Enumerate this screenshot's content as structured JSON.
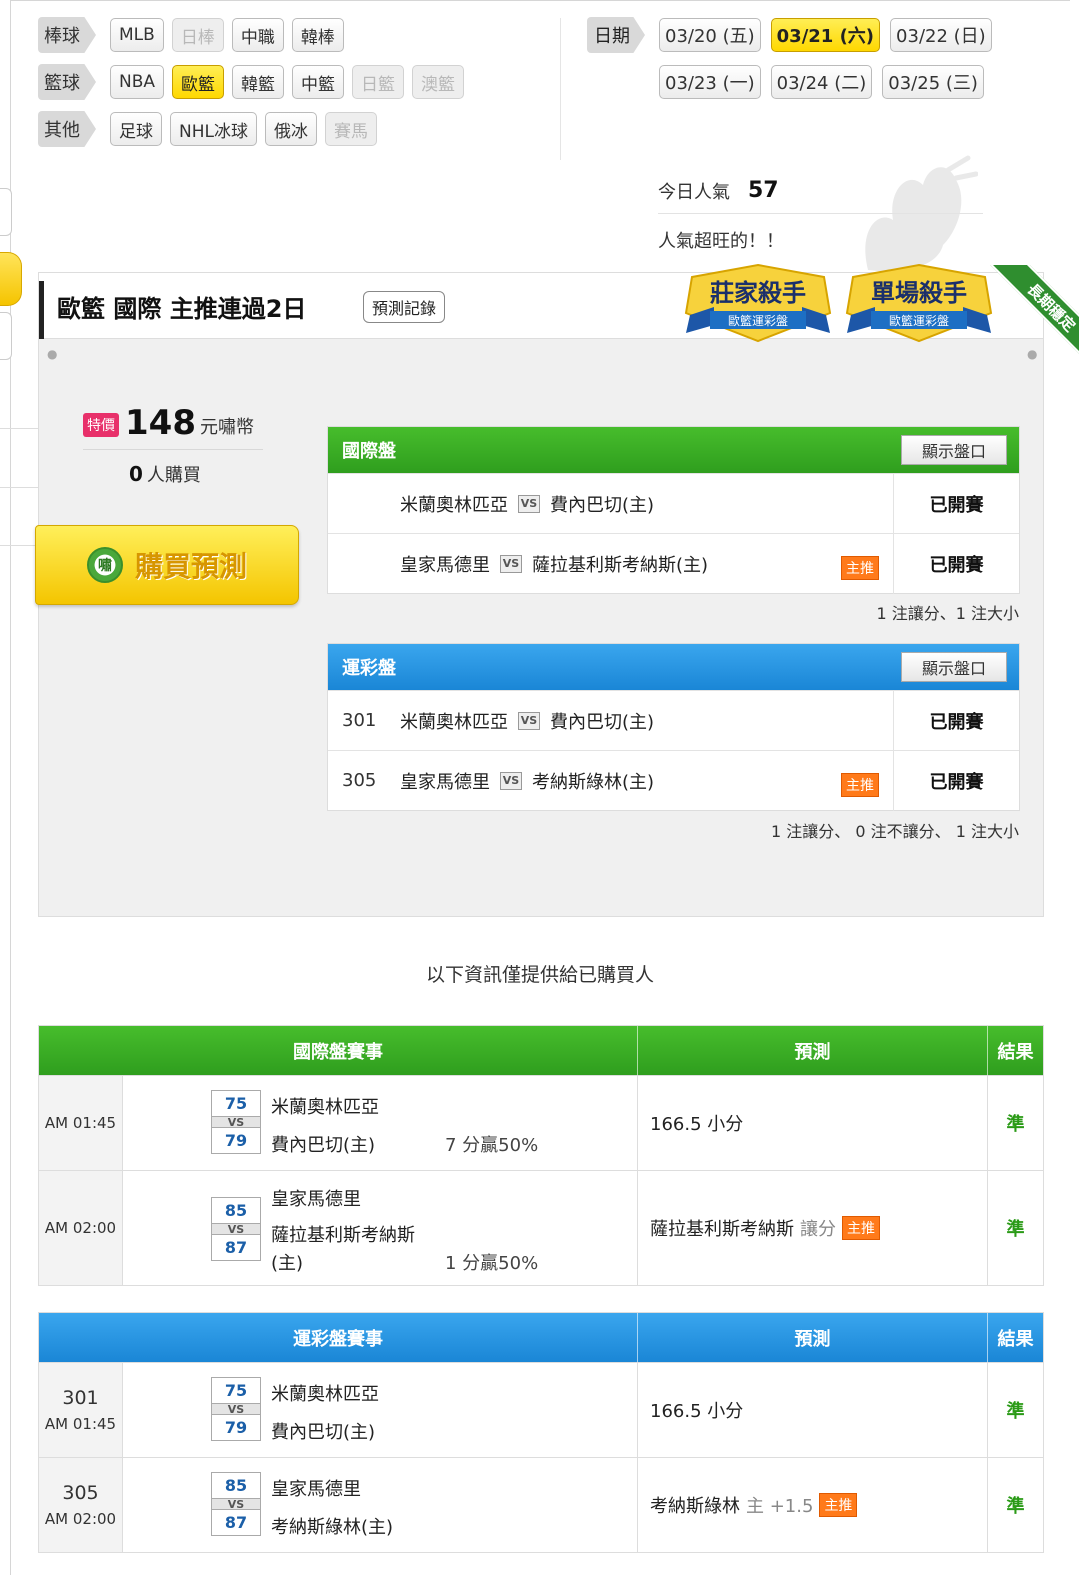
{
  "categories": [
    {
      "label": "棒球",
      "items": [
        {
          "label": "MLB",
          "state": "normal"
        },
        {
          "label": "日棒",
          "state": "disabled"
        },
        {
          "label": "中職",
          "state": "normal"
        },
        {
          "label": "韓棒",
          "state": "normal"
        }
      ]
    },
    {
      "label": "籃球",
      "items": [
        {
          "label": "NBA",
          "state": "normal"
        },
        {
          "label": "歐籃",
          "state": "active"
        },
        {
          "label": "韓籃",
          "state": "normal"
        },
        {
          "label": "中籃",
          "state": "normal"
        },
        {
          "label": "日籃",
          "state": "disabled"
        },
        {
          "label": "澳籃",
          "state": "disabled"
        }
      ]
    },
    {
      "label": "其他",
      "items": [
        {
          "label": "足球",
          "state": "normal"
        },
        {
          "label": "NHL冰球",
          "state": "normal"
        },
        {
          "label": "俄冰",
          "state": "normal"
        },
        {
          "label": "賽馬",
          "state": "disabled"
        }
      ]
    }
  ],
  "dates": {
    "label": "日期",
    "items": [
      {
        "label": "03/20 (五)",
        "active": false
      },
      {
        "label": "03/21 (六)",
        "active": true
      },
      {
        "label": "03/22 (日)",
        "active": false
      },
      {
        "label": "03/23 (一)",
        "active": false
      },
      {
        "label": "03/24 (二)",
        "active": false
      },
      {
        "label": "03/25 (三)",
        "active": false
      }
    ]
  },
  "popularity": {
    "label": "今日人氣",
    "value": "57",
    "message": "人氣超旺的！！"
  },
  "panel": {
    "title": "歐籃 國際 主推連過2日",
    "record_button": "預測記錄",
    "badge1": {
      "title": "莊家殺手",
      "sub": "歐籃運彩盤"
    },
    "badge2": {
      "title": "單場殺手",
      "sub": "歐籃運彩盤"
    },
    "corner_ribbon": "長期穩定",
    "price_tag": "特價",
    "price": "148",
    "price_unit": "元嘯幣",
    "buyers_count": "0",
    "buyers_label": "人購買",
    "buy_coin": "嘯",
    "buy_button": "購買預測",
    "intl": {
      "title": "國際盤",
      "show_button": "顯示盤口",
      "rows": [
        {
          "no": "",
          "home": "米蘭奧林匹亞",
          "away": "費內巴切(主)",
          "main": false,
          "status": "已開賽"
        },
        {
          "no": "",
          "home": "皇家馬德里",
          "away": "薩拉基利斯考納斯(主)",
          "main": true,
          "status": "已開賽"
        }
      ],
      "note": "1 注讓分、1 注大小"
    },
    "lottery": {
      "title": "運彩盤",
      "show_button": "顯示盤口",
      "rows": [
        {
          "no": "301",
          "home": "米蘭奧林匹亞",
          "away": "費內巴切(主)",
          "main": false,
          "status": "已開賽"
        },
        {
          "no": "305",
          "home": "皇家馬德里",
          "away": "考納斯綠林(主)",
          "main": true,
          "status": "已開賽"
        }
      ],
      "note": "1 注讓分、 0 注不讓分、 1 注大小"
    },
    "vs": "VS",
    "main_pick": "主推"
  },
  "info_message": "以下資訊僅提供給已購買人",
  "results_intl": {
    "headers": [
      "國際盤賽事",
      "預測",
      "結果"
    ],
    "rows": [
      {
        "time": "AM 01:45",
        "score1": "75",
        "score2": "79",
        "team1": "米蘭奧林匹亞",
        "team2": "費內巴切(主)",
        "margin": "7 分贏50%",
        "prediction": "166.5 小分",
        "pred_extra": "",
        "main": false,
        "result": "準"
      },
      {
        "time": "AM 02:00",
        "score1": "85",
        "score2": "87",
        "team1": "皇家馬德里",
        "team2a": "薩拉基利斯考納斯",
        "team2b": "(主)",
        "margin": "1 分贏50%",
        "prediction": "薩拉基利斯考納斯",
        "pred_extra": "讓分",
        "main": true,
        "result": "準"
      }
    ]
  },
  "results_lottery": {
    "headers": [
      "運彩盤賽事",
      "預測",
      "結果"
    ],
    "rows": [
      {
        "no": "301",
        "time": "AM 01:45",
        "score1": "75",
        "score2": "79",
        "team1": "米蘭奧林匹亞",
        "team2": "費內巴切(主)",
        "prediction": "166.5 小分",
        "pred_extra": "",
        "main": false,
        "result": "準"
      },
      {
        "no": "305",
        "time": "AM 02:00",
        "score1": "85",
        "score2": "87",
        "team1": "皇家馬德里",
        "team2": "考納斯綠林(主)",
        "prediction": "考納斯綠林",
        "pred_extra": "主 +1.5",
        "main": true,
        "result": "準"
      }
    ]
  },
  "score_vs": "VS"
}
